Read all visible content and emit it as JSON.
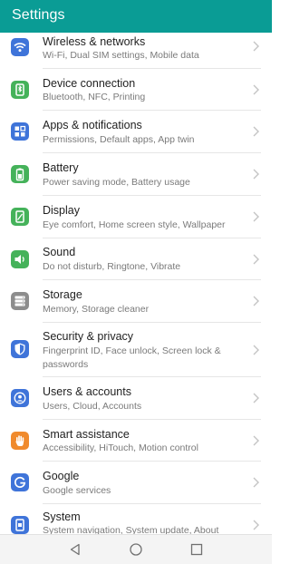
{
  "header": {
    "title": "Settings"
  },
  "colors": {
    "app_bar": "#0a9c95",
    "icon_blue": "#3f74d9",
    "icon_green": "#45b25a",
    "icon_gray": "#8d8d8d",
    "icon_orange": "#f08a2c"
  },
  "settings": [
    {
      "label": "Wireless & networks",
      "summary": "Wi-Fi, Dual SIM settings, Mobile data",
      "icon": "wifi-icon",
      "color": "#3f74d9"
    },
    {
      "label": "Device connection",
      "summary": "Bluetooth, NFC, Printing",
      "icon": "device-connection-icon",
      "color": "#45b25a"
    },
    {
      "label": "Apps & notifications",
      "summary": "Permissions, Default apps, App twin",
      "icon": "apps-grid-icon",
      "color": "#3f74d9"
    },
    {
      "label": "Battery",
      "summary": "Power saving mode, Battery usage",
      "icon": "battery-icon",
      "color": "#45b25a"
    },
    {
      "label": "Display",
      "summary": "Eye comfort, Home screen style, Wallpaper",
      "icon": "display-icon",
      "color": "#45b25a"
    },
    {
      "label": "Sound",
      "summary": "Do not disturb, Ringtone, Vibrate",
      "icon": "speaker-icon",
      "color": "#45b25a"
    },
    {
      "label": "Storage",
      "summary": "Memory, Storage cleaner",
      "icon": "storage-icon",
      "color": "#8d8d8d"
    },
    {
      "label": "Security & privacy",
      "summary": "Fingerprint ID, Face unlock, Screen lock & passwords",
      "icon": "shield-icon",
      "color": "#3f74d9"
    },
    {
      "label": "Users & accounts",
      "summary": "Users, Cloud, Accounts",
      "icon": "user-icon",
      "color": "#3f74d9"
    },
    {
      "label": "Smart assistance",
      "summary": "Accessibility, HiTouch, Motion control",
      "icon": "hand-icon",
      "color": "#f08a2c"
    },
    {
      "label": "Google",
      "summary": "Google services",
      "icon": "google-icon",
      "color": "#3f74d9"
    },
    {
      "label": "System",
      "summary": "System navigation, System update, About",
      "icon": "system-icon",
      "color": "#3f74d9"
    }
  ],
  "nav": [
    {
      "icon": "back-icon"
    },
    {
      "icon": "home-icon"
    },
    {
      "icon": "recents-icon"
    }
  ]
}
